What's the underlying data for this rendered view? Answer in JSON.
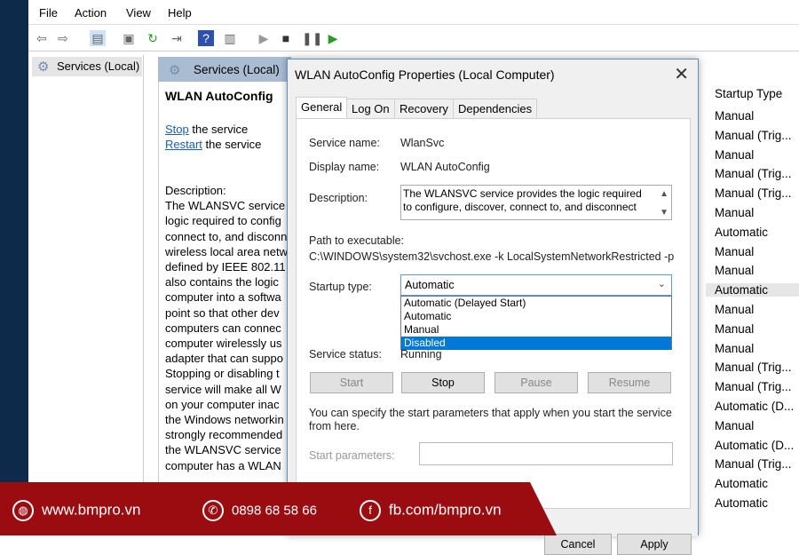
{
  "menu": [
    "File",
    "Action",
    "View",
    "Help"
  ],
  "tree": {
    "item": "Services (Local)"
  },
  "main": {
    "header": "Services (Local)",
    "service_title": "WLAN AutoConfig",
    "stop_link": "Stop",
    "stop_suffix": " the service",
    "restart_link": "Restart",
    "restart_suffix": " the service",
    "description_lines": [
      "Description:",
      "The WLANSVC service",
      "logic required to config",
      "connect to, and disconn",
      "wireless local area netw",
      "defined by IEEE 802.11",
      "also contains the logic",
      "computer into a softwa",
      "point so that other dev",
      "computers can connec",
      "computer wirelessly us",
      "adapter that can suppo",
      "Stopping or disabling t",
      "service will make all W",
      "on your computer inac",
      "the Windows networkin",
      "strongly recommended",
      "the WLANSVC service",
      "computer has a WLAN"
    ]
  },
  "startup_column": {
    "header": "Startup Type",
    "rows": [
      "Manual",
      "Manual (Trig...",
      "Manual",
      "Manual (Trig...",
      "Manual (Trig...",
      "Manual",
      "Automatic",
      "Manual",
      "Manual",
      "Automatic",
      "Manual",
      "Manual",
      "Manual",
      "Manual (Trig...",
      "Manual (Trig...",
      "Automatic (D...",
      "Manual",
      "Automatic (D...",
      "Manual (Trig...",
      "Automatic",
      "Automatic"
    ],
    "selected_index": 9
  },
  "dialog": {
    "title": "WLAN AutoConfig Properties (Local Computer)",
    "close": "✕",
    "tabs": [
      "General",
      "Log On",
      "Recovery",
      "Dependencies"
    ],
    "active_tab": "General",
    "service_name_label": "Service name:",
    "service_name": "WlanSvc",
    "display_name_label": "Display name:",
    "display_name": "WLAN AutoConfig",
    "description_label": "Description:",
    "description": "The WLANSVC service provides the logic required to configure, discover, connect to, and disconnect",
    "path_label": "Path to executable:",
    "path": "C:\\WINDOWS\\system32\\svchost.exe -k LocalSystemNetworkRestricted -p",
    "startup_label": "Startup type:",
    "startup_value": "Automatic",
    "startup_options": [
      "Automatic (Delayed Start)",
      "Automatic",
      "Manual",
      "Disabled"
    ],
    "highlighted_option": "Disabled",
    "status_label": "Service status:",
    "status": "Running",
    "buttons": {
      "start": "Start",
      "stop": "Stop",
      "pause": "Pause",
      "resume": "Resume"
    },
    "hint": "You can specify the start parameters that apply when you start the service from here.",
    "params_label": "Start parameters:",
    "params_value": "",
    "cancel": "Cancel",
    "apply": "Apply"
  },
  "banner": {
    "website": "www.bmpro.vn",
    "phone": "0898 68 58 66",
    "facebook": "fb.com/bmpro.vn",
    "color": "#9b0c10"
  }
}
